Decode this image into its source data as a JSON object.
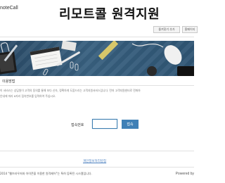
{
  "header": {
    "logo_text": "noteCall",
    "title": "리모트콜 원격지원",
    "bookmark_button": "즐겨찾기 추가",
    "second_button": "홈페이지"
  },
  "section": {
    "title": "이용방법",
    "desc_line1": "이 서비스는 상담원이 고객의 동의를 통해 보다 신속, 정확하게 도움드리는 고객지원서비스입니다. 먼저 고객지원센터로 전화하",
    "desc_line2": "안내에 따라 6자리 접속번호를 입력하여 주십시오."
  },
  "form": {
    "password_label": "접속번호",
    "password_value": "",
    "submit_label": "접속"
  },
  "links": {
    "privacy": "개인정보처리방침"
  },
  "footer": {
    "copyright": "2014 \"웹브라우저와 아이콘을 이용한 원격제어\"는 특허 등록된 시스템입니다.",
    "powered_by": "Powered by"
  },
  "colors": {
    "accent": "#3f80b6",
    "banner": "#2f5574"
  }
}
